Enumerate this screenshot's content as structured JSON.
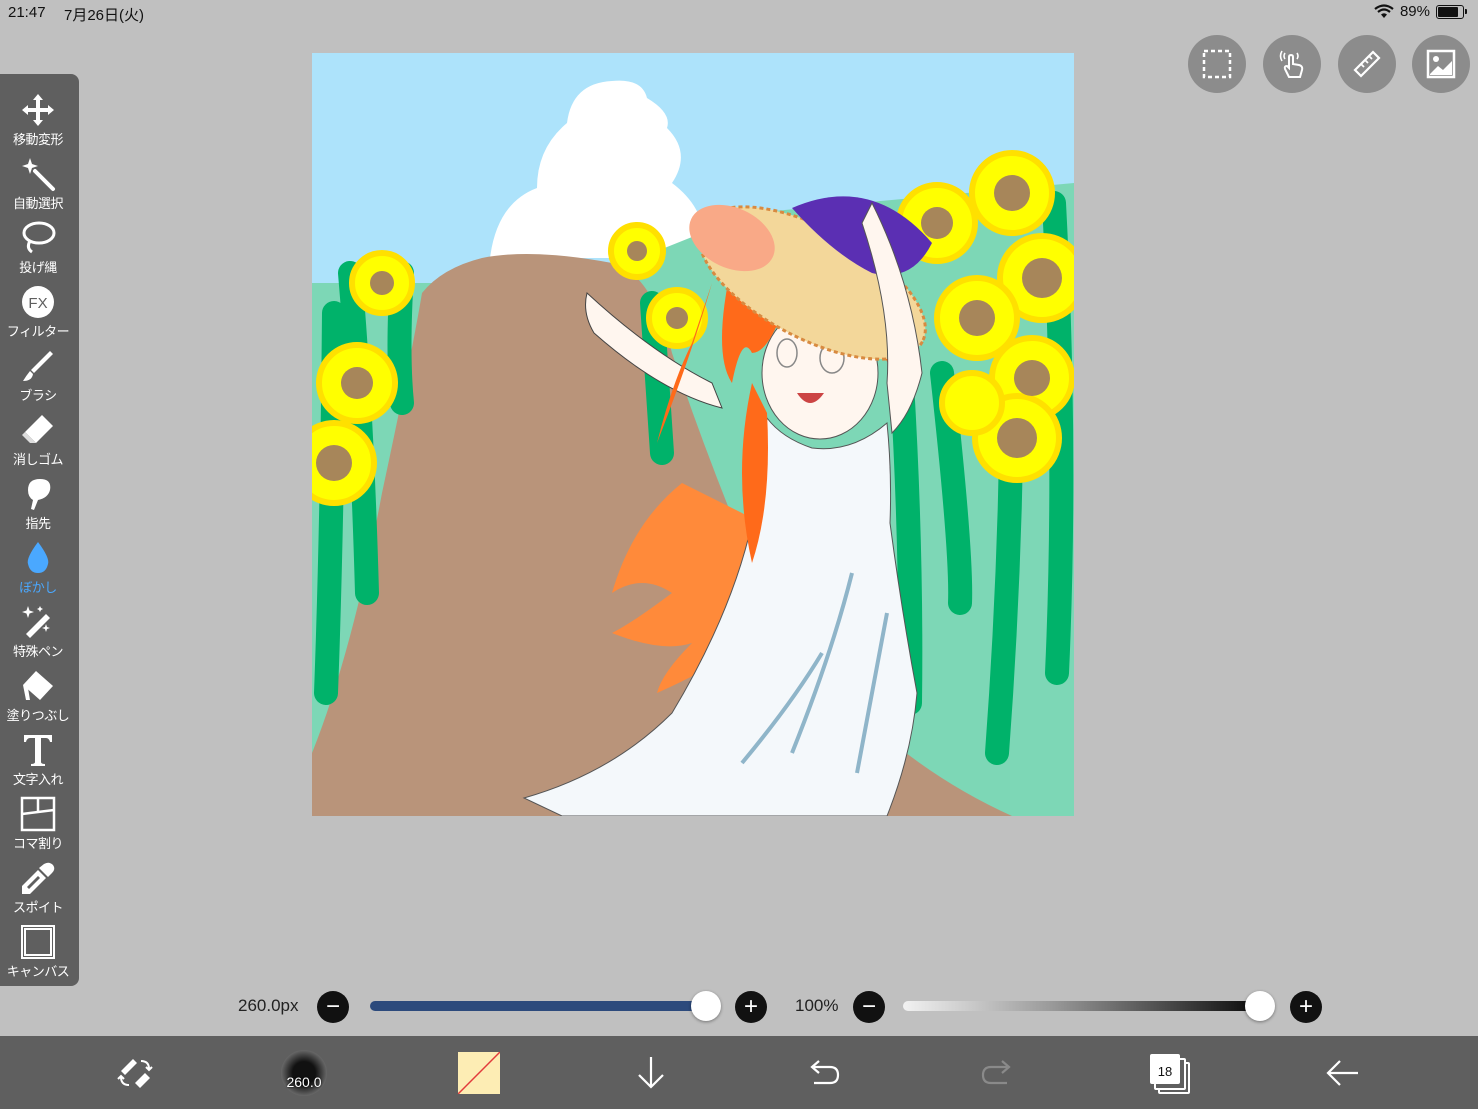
{
  "status_bar": {
    "time": "21:47",
    "date": "7月26日(火)",
    "battery_percent": "89%",
    "battery_level": 0.89
  },
  "toolbar": {
    "tools": [
      {
        "label": "移動変形",
        "icon": "move-transform-icon",
        "active": false
      },
      {
        "label": "自動選択",
        "icon": "magic-wand-icon",
        "active": false
      },
      {
        "label": "投げ縄",
        "icon": "lasso-icon",
        "active": false
      },
      {
        "label": "フィルター",
        "icon": "fx-filter-icon",
        "active": false
      },
      {
        "label": "ブラシ",
        "icon": "brush-icon",
        "active": false
      },
      {
        "label": "消しゴム",
        "icon": "eraser-icon",
        "active": false
      },
      {
        "label": "指先",
        "icon": "smudge-finger-icon",
        "active": false
      },
      {
        "label": "ぼかし",
        "icon": "blur-drop-icon",
        "active": true
      },
      {
        "label": "特殊ペン",
        "icon": "special-pen-icon",
        "active": false
      },
      {
        "label": "塗りつぶし",
        "icon": "fill-bucket-icon",
        "active": false
      },
      {
        "label": "文字入れ",
        "icon": "text-tool-icon",
        "active": false
      },
      {
        "label": "コマ割り",
        "icon": "frame-divider-icon",
        "active": false
      },
      {
        "label": "スポイト",
        "icon": "eyedropper-icon",
        "active": false
      },
      {
        "label": "キャンバス",
        "icon": "canvas-icon",
        "active": false
      }
    ],
    "active_color": "#4aa8ff"
  },
  "top_buttons": [
    "selection-icon",
    "touch-gesture-icon",
    "ruler-icon",
    "reference-image-icon"
  ],
  "size_slider": {
    "value_label": "260.0px",
    "fraction": 1.0,
    "color": "#2c4a7c"
  },
  "opacity_slider": {
    "value_label": "100%",
    "fraction": 1.0
  },
  "bottom_bar": {
    "brush_size_label": "260.0",
    "primary_color": "#fdedb4",
    "layer_count": "18",
    "icons": [
      "swap-tool-icon",
      "brush-preview",
      "color-swatch",
      "download-arrow-icon",
      "undo-icon",
      "redo-icon",
      "layers-icon",
      "back-arrow-icon"
    ]
  }
}
